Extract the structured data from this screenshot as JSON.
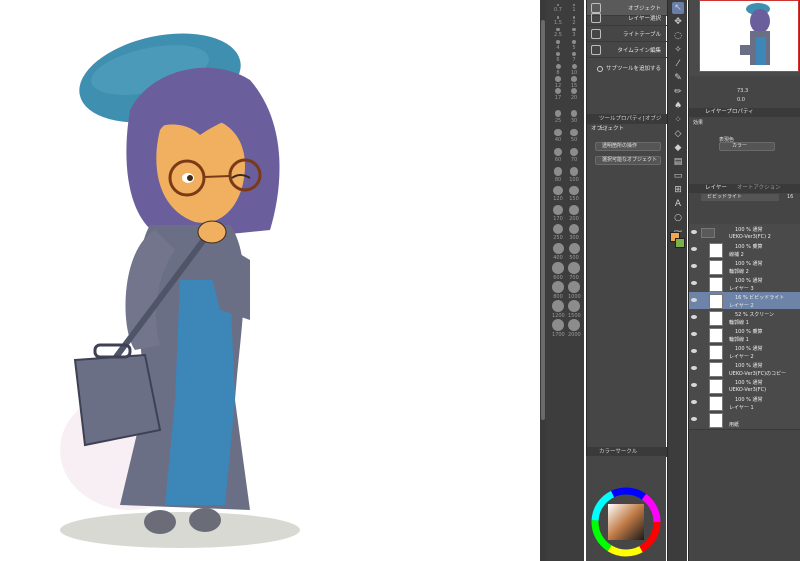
{
  "subtool": {
    "tab_label": "オブジェクト",
    "items": [
      {
        "label": "オブジェクト",
        "active": true
      },
      {
        "label": "レイヤー選択"
      },
      {
        "label": "ライトテーブル"
      },
      {
        "label": "タイムライン編集"
      }
    ],
    "add_label": "サブツールを追加する"
  },
  "tool_property": {
    "title": "ツールプロパティ[オブジェ]",
    "section": "オブジェクト",
    "dropdown1": "透明箇所の操作",
    "dropdown2": "選択可能なオブジェクト"
  },
  "brush_sizes": [
    "0.7",
    "1",
    "1.5",
    "2",
    "2.5",
    "3",
    "4",
    "5",
    "6",
    "7",
    "8",
    "10",
    "12",
    "15",
    "17",
    "20",
    "25",
    "30",
    "40",
    "50",
    "60",
    "70",
    "80",
    "100",
    "120",
    "150",
    "170",
    "200",
    "250",
    "300",
    "400",
    "500",
    "600",
    "700",
    "800",
    "1000",
    "1200",
    "1500",
    "1700",
    "2000"
  ],
  "navigator": {
    "zoom": "73.3",
    "angle": "0.0"
  },
  "layer_property": {
    "title": "レイヤープロパティ",
    "effect": "効果",
    "color_label": "表現色",
    "color_value": "カラー"
  },
  "layer_panel": {
    "tab1": "レイヤー",
    "tab2": "オートアクション",
    "blend": "ビビッドライト",
    "opacity": "16",
    "layers": [
      {
        "line1": "100 % 通常",
        "line2": "UEKO-Ver3(FC) 2",
        "type": "folder"
      },
      {
        "line1": "100 % 乗算",
        "line2": "線補 2"
      },
      {
        "line1": "100 % 通常",
        "line2": "輪郭線 2"
      },
      {
        "line1": "100 % 通常",
        "line2": "レイヤー 3"
      },
      {
        "line1": "16 % ビビッドライト",
        "line2": "レイヤー 2",
        "selected": true
      },
      {
        "line1": "52 % スクリーン",
        "line2": "輪郭線 1"
      },
      {
        "line1": "100 % 乗算",
        "line2": "輪郭線 1"
      },
      {
        "line1": "100 % 通常",
        "line2": "レイヤー 2"
      },
      {
        "line1": "100 % 通常",
        "line2": "UEKO-Ver3(FC)のコピー"
      },
      {
        "line1": "100 % 通常",
        "line2": "UEKO-Ver3(FC)"
      },
      {
        "line1": "100 % 通常",
        "line2": "レイヤー 1"
      },
      {
        "line1": "",
        "line2": "用紙"
      }
    ]
  },
  "color_panel": {
    "title": "カラーサークル"
  },
  "colors": {
    "main": "#f0a850",
    "sub": "#7db04a",
    "hat": "#3f8fb0",
    "hair": "#6a5f9c",
    "coat": "#6b6f86",
    "dress": "#3c86b8",
    "skin": "#f0b060"
  }
}
